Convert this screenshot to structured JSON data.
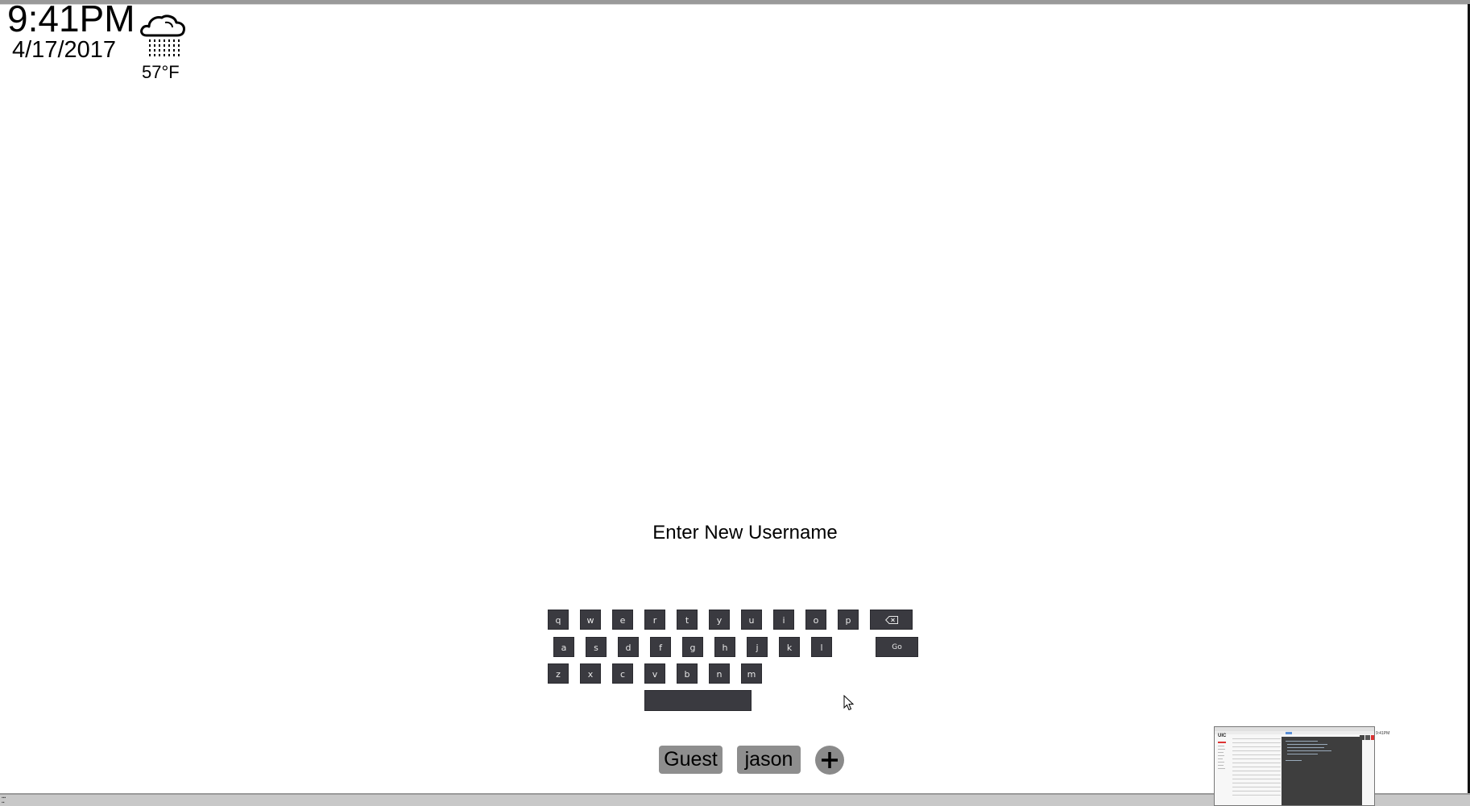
{
  "clock": {
    "time": "9:41PM",
    "date": "4/17/2017"
  },
  "weather": {
    "icon": "rain-cloud-icon",
    "temperature": "57°F"
  },
  "prompt": "Enter New Username",
  "keyboard": {
    "row1": [
      "q",
      "w",
      "e",
      "r",
      "t",
      "y",
      "u",
      "i",
      "o",
      "p"
    ],
    "row2": [
      "a",
      "s",
      "d",
      "f",
      "g",
      "h",
      "j",
      "k",
      "l"
    ],
    "row3": [
      "z",
      "x",
      "c",
      "v",
      "b",
      "n",
      "m"
    ],
    "backspace_icon": "backspace-icon",
    "go_label": "Go",
    "key_color": "#3a3a40"
  },
  "users": {
    "guest_label": "Guest",
    "jason_label": "jason",
    "add_icon": "plus-icon"
  },
  "thumbnail": {
    "logo": "UIC",
    "side_time": "9:41PM"
  }
}
